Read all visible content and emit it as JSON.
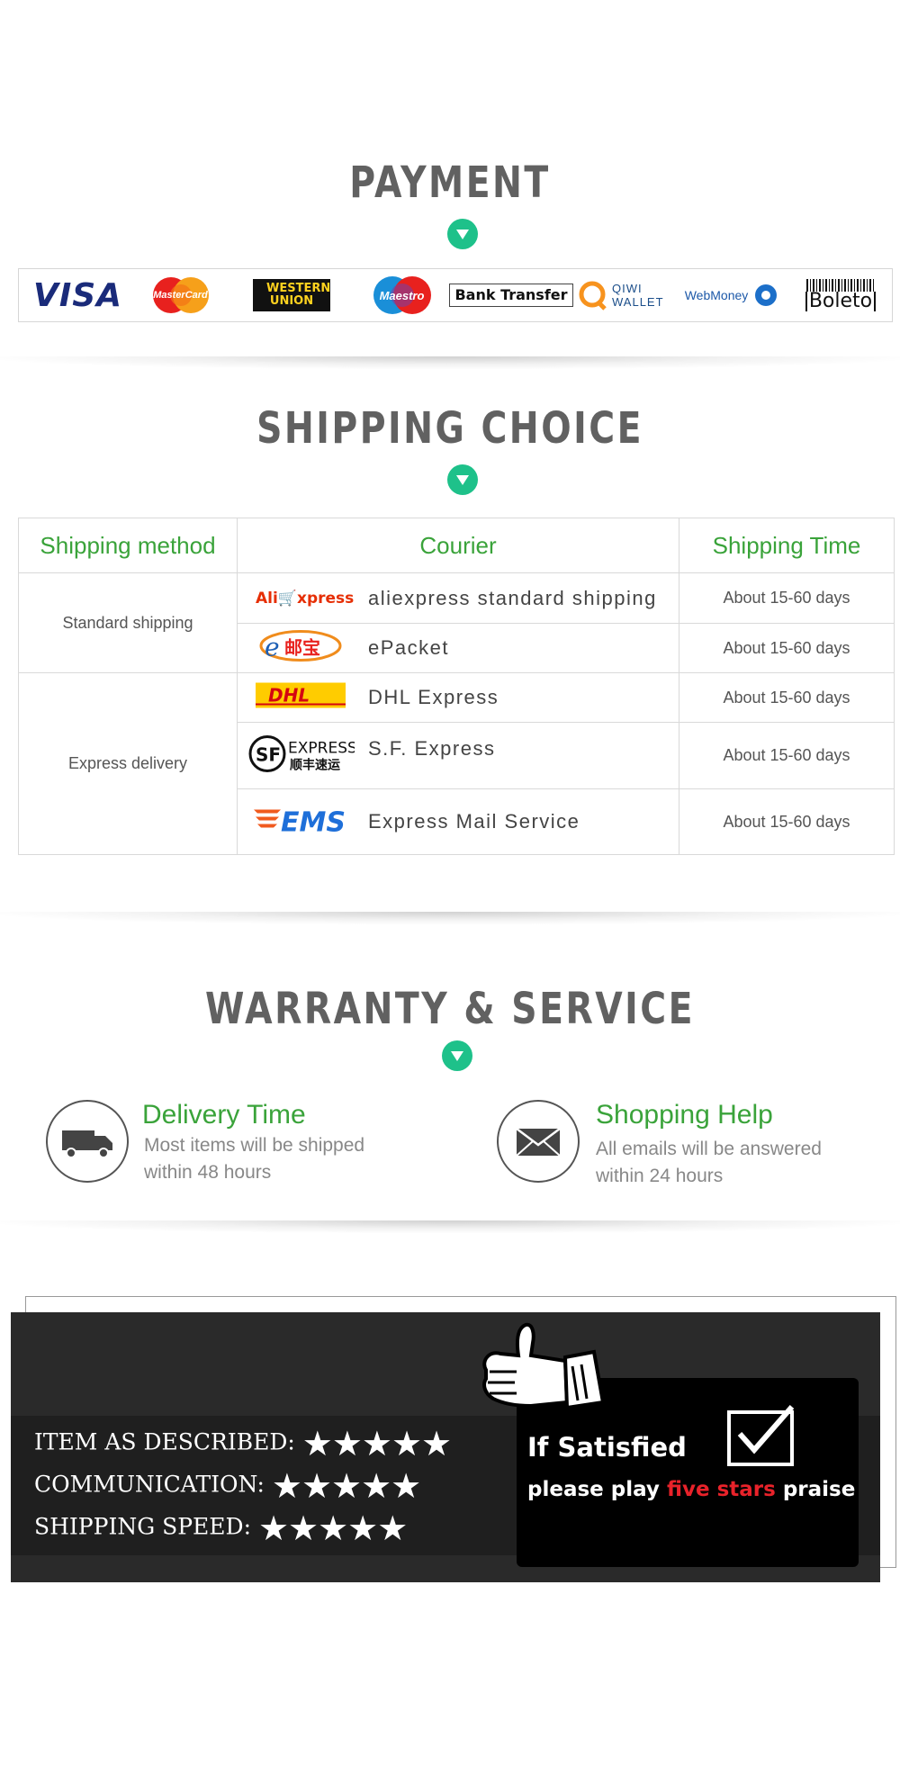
{
  "payment": {
    "title": "PAYMENT",
    "logos": [
      "VISA",
      "MasterCard",
      "WESTERN UNION",
      "Maestro",
      "Bank Transfer",
      "QIWI WALLET",
      "WebMoney",
      "Boleto"
    ]
  },
  "shipping": {
    "title": "SHIPPING CHOICE",
    "headers": [
      "Shipping method",
      "Courier",
      "Shipping Time"
    ],
    "groups": [
      {
        "method": "Standard shipping"
      },
      {
        "method": "Express delivery"
      }
    ],
    "rows": [
      {
        "logo": "AliExpress",
        "courier": "aliexpress standard shipping",
        "time": "About 15-60 days"
      },
      {
        "logo": "e邮宝",
        "courier": "ePacket",
        "time": "About 15-60 days"
      },
      {
        "logo": "DHL",
        "courier": "DHL Express",
        "time": "About 15-60 days"
      },
      {
        "logo": "SF EXPRESS 顺丰速运",
        "courier": "S.F. Express",
        "time": "About 15-60 days"
      },
      {
        "logo": "EMS",
        "courier": "Express Mail Service",
        "time": "About 15-60 days"
      }
    ]
  },
  "warranty": {
    "title": "WARRANTY & SERVICE",
    "items": [
      {
        "title": "Delivery Time",
        "line1": "Most items will be shipped",
        "line2": "within 48 hours",
        "icon": "truck-icon"
      },
      {
        "title": "Shopping Help",
        "line1": "All emails will be answered",
        "line2": "within 24 hours",
        "icon": "envelope-icon"
      }
    ]
  },
  "feedback": {
    "rows": [
      {
        "label": "ITEM AS DESCRIBED:",
        "stars": 5
      },
      {
        "label": "COMMUNICATION:",
        "stars": 5
      },
      {
        "label": "SHIPPING SPEED:",
        "stars": 5
      }
    ],
    "star_glyphs": "★★★★★",
    "if_satisfied": "If Satisfied",
    "please_play": "please play",
    "five_stars": "five stars",
    "praise": "praise",
    "accent": "#e8222a"
  },
  "colors": {
    "green_heading": "#3aa33a",
    "arrow_green": "#1ec18a",
    "title_grey": "#616161"
  }
}
